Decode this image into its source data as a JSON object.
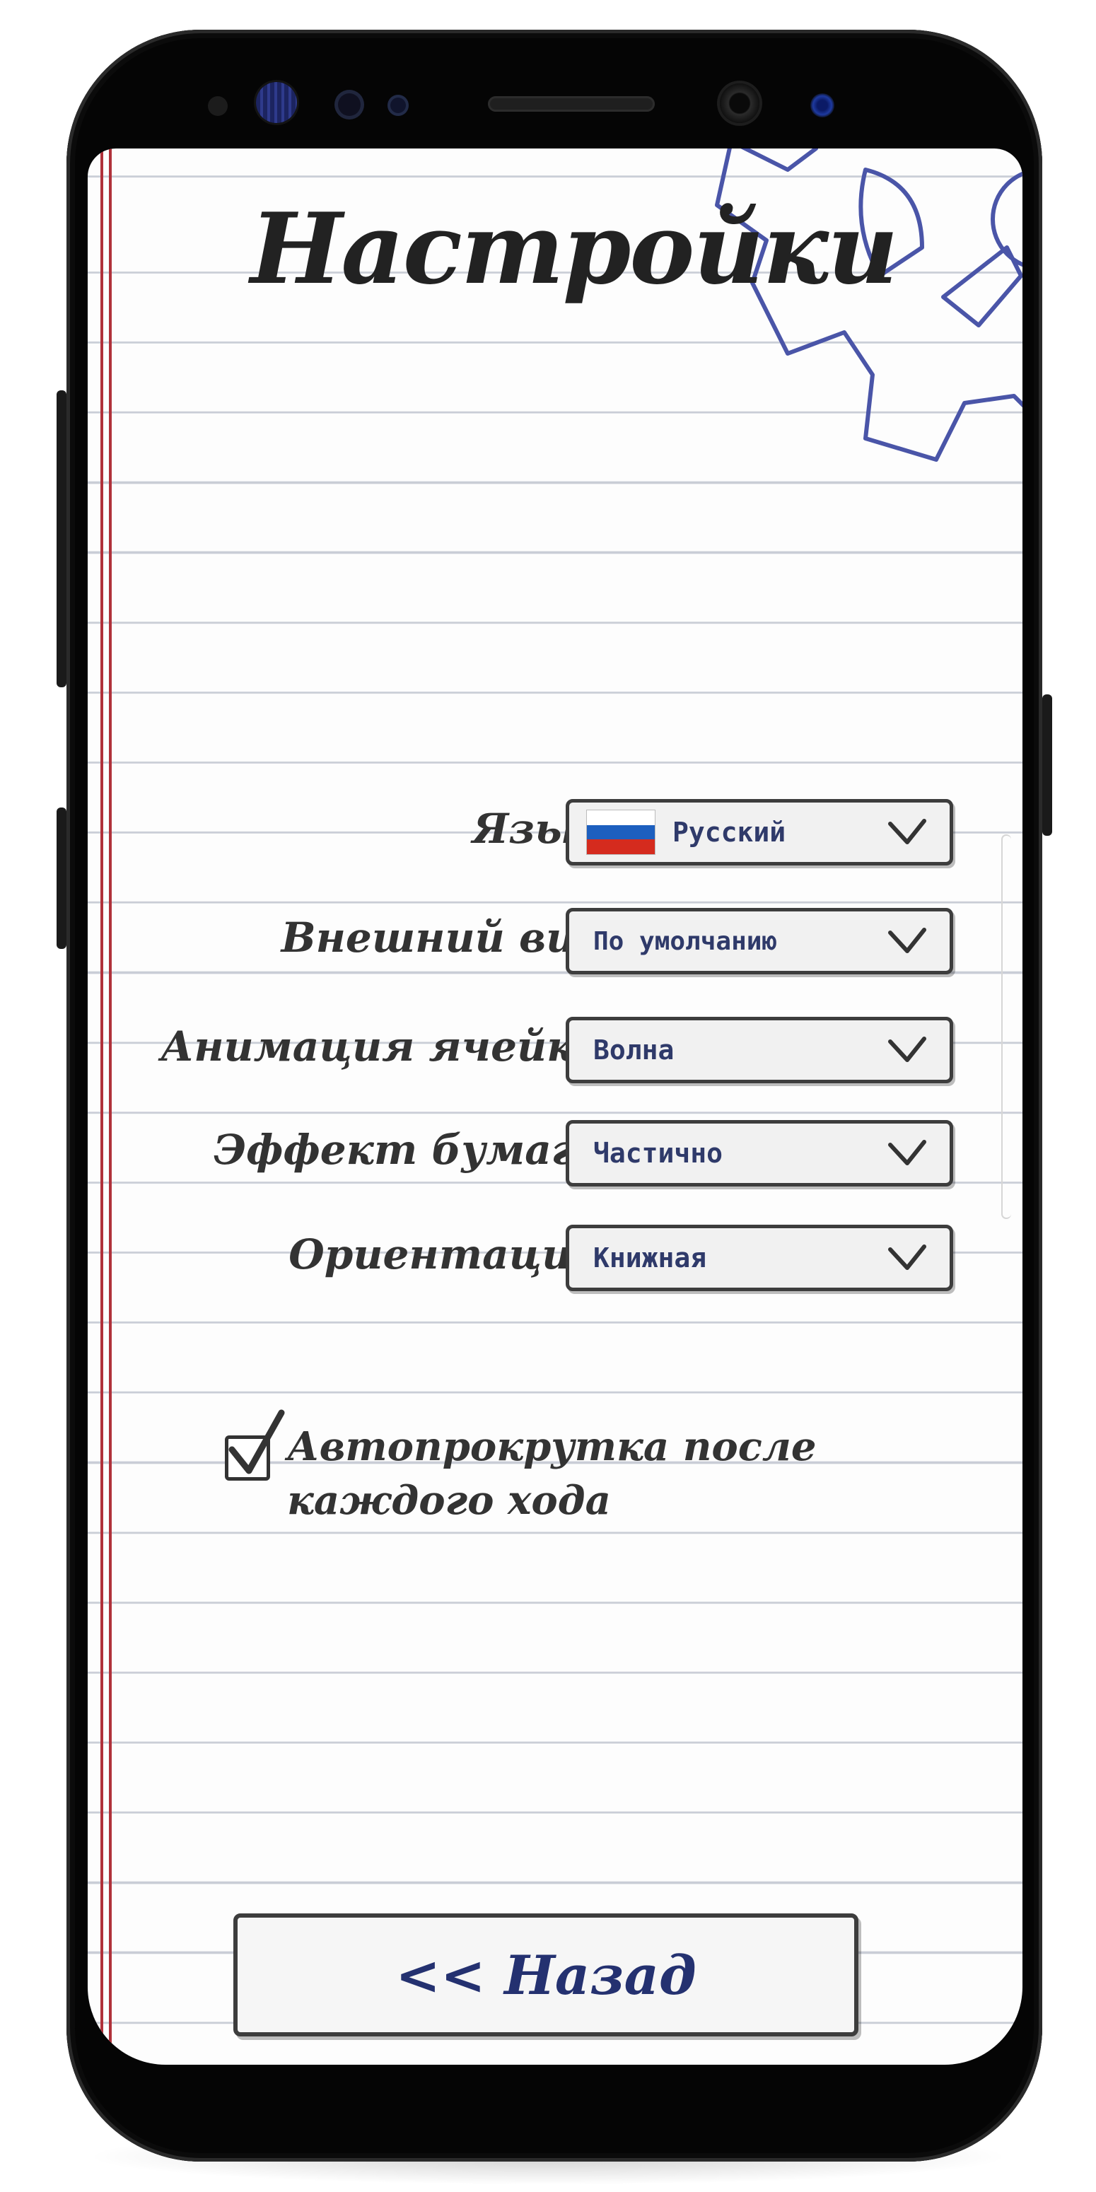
{
  "screen": {
    "title": "Настройки",
    "settings": [
      {
        "label": "Язык:",
        "value": "Русский",
        "flag": "russia-flag"
      },
      {
        "label": "Внешний вид:",
        "value": "По умолчанию"
      },
      {
        "label": "Анимация ячейки:",
        "value": "Волна"
      },
      {
        "label": "Эффект бумаги:",
        "value": "Частично"
      },
      {
        "label": "Ориентация:",
        "value": "Книжная"
      }
    ],
    "autoscroll": {
      "checked": true,
      "label_line1": "Автопрокрутка после",
      "label_line2": "каждого хода"
    },
    "back_button": "<< Назад"
  },
  "colors": {
    "paper": "#fdfdfd",
    "ruled_line": "#c9cdd6",
    "margin_line": "#b0313a",
    "gear_ink": "#4a55a8",
    "button_text": "#243170"
  },
  "icons": {
    "gear": "gear-icon",
    "dropdown": "chevron-down-icon",
    "checkbox": "check-icon"
  }
}
